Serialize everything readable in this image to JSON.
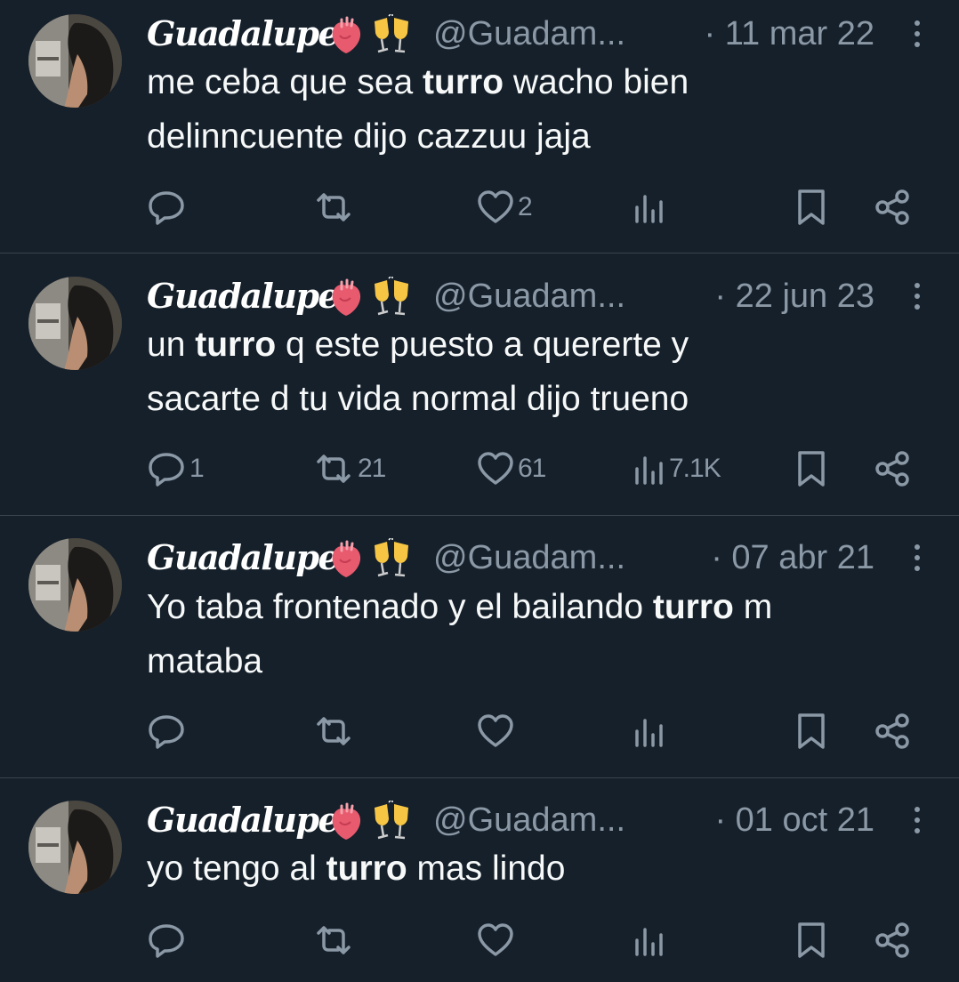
{
  "user": {
    "name": "Guadalupe",
    "handle": "@Guadam...",
    "emoji_1": "anatomical-heart-icon",
    "emoji_2": "clinking-glasses-icon"
  },
  "colors": {
    "background": "#15202b",
    "secondary_text": "#8b98a5",
    "divider": "#38444d"
  },
  "tweets": [
    {
      "date": "· 11 mar 22",
      "lines": [
        {
          "pre": "me ceba que sea ",
          "bold": "turro",
          "post": " wacho bien"
        },
        {
          "pre": "delinncuente dijo cazzuu jaja",
          "bold": "",
          "post": ""
        }
      ],
      "replies": "",
      "retweets": "",
      "likes": "2",
      "views": ""
    },
    {
      "date": "· 22 jun 23",
      "lines": [
        {
          "pre": "un ",
          "bold": "turro",
          "post": " q este puesto a quererte y"
        },
        {
          "pre": "sacarte d tu vida normal dijo trueno",
          "bold": "",
          "post": ""
        }
      ],
      "replies": "1",
      "retweets": "21",
      "likes": "61",
      "views": "7.1K"
    },
    {
      "date": "· 07 abr 21",
      "lines": [
        {
          "pre": "Yo taba frontenado y el bailando ",
          "bold": "turro",
          "post": " m"
        },
        {
          "pre": "mataba",
          "bold": "",
          "post": ""
        }
      ],
      "replies": "",
      "retweets": "",
      "likes": "",
      "views": ""
    },
    {
      "date": "· 01 oct 21",
      "lines": [
        {
          "pre": "yo tengo al ",
          "bold": "turro",
          "post": " mas lindo"
        }
      ],
      "replies": "",
      "retweets": "",
      "likes": "",
      "views": ""
    }
  ]
}
